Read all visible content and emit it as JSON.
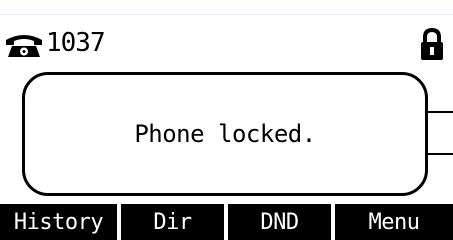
{
  "status_bar": {
    "phone_icon": "phone-icon",
    "account": "1037",
    "lock_icon": "lock-icon"
  },
  "message": {
    "text": "Phone locked."
  },
  "softkeys": [
    {
      "label": "History"
    },
    {
      "label": "Dir"
    },
    {
      "label": "DND"
    },
    {
      "label": "Menu"
    }
  ],
  "colors": {
    "background": "#ffffff",
    "foreground": "#000000",
    "softkey_text": "#ffffff"
  }
}
